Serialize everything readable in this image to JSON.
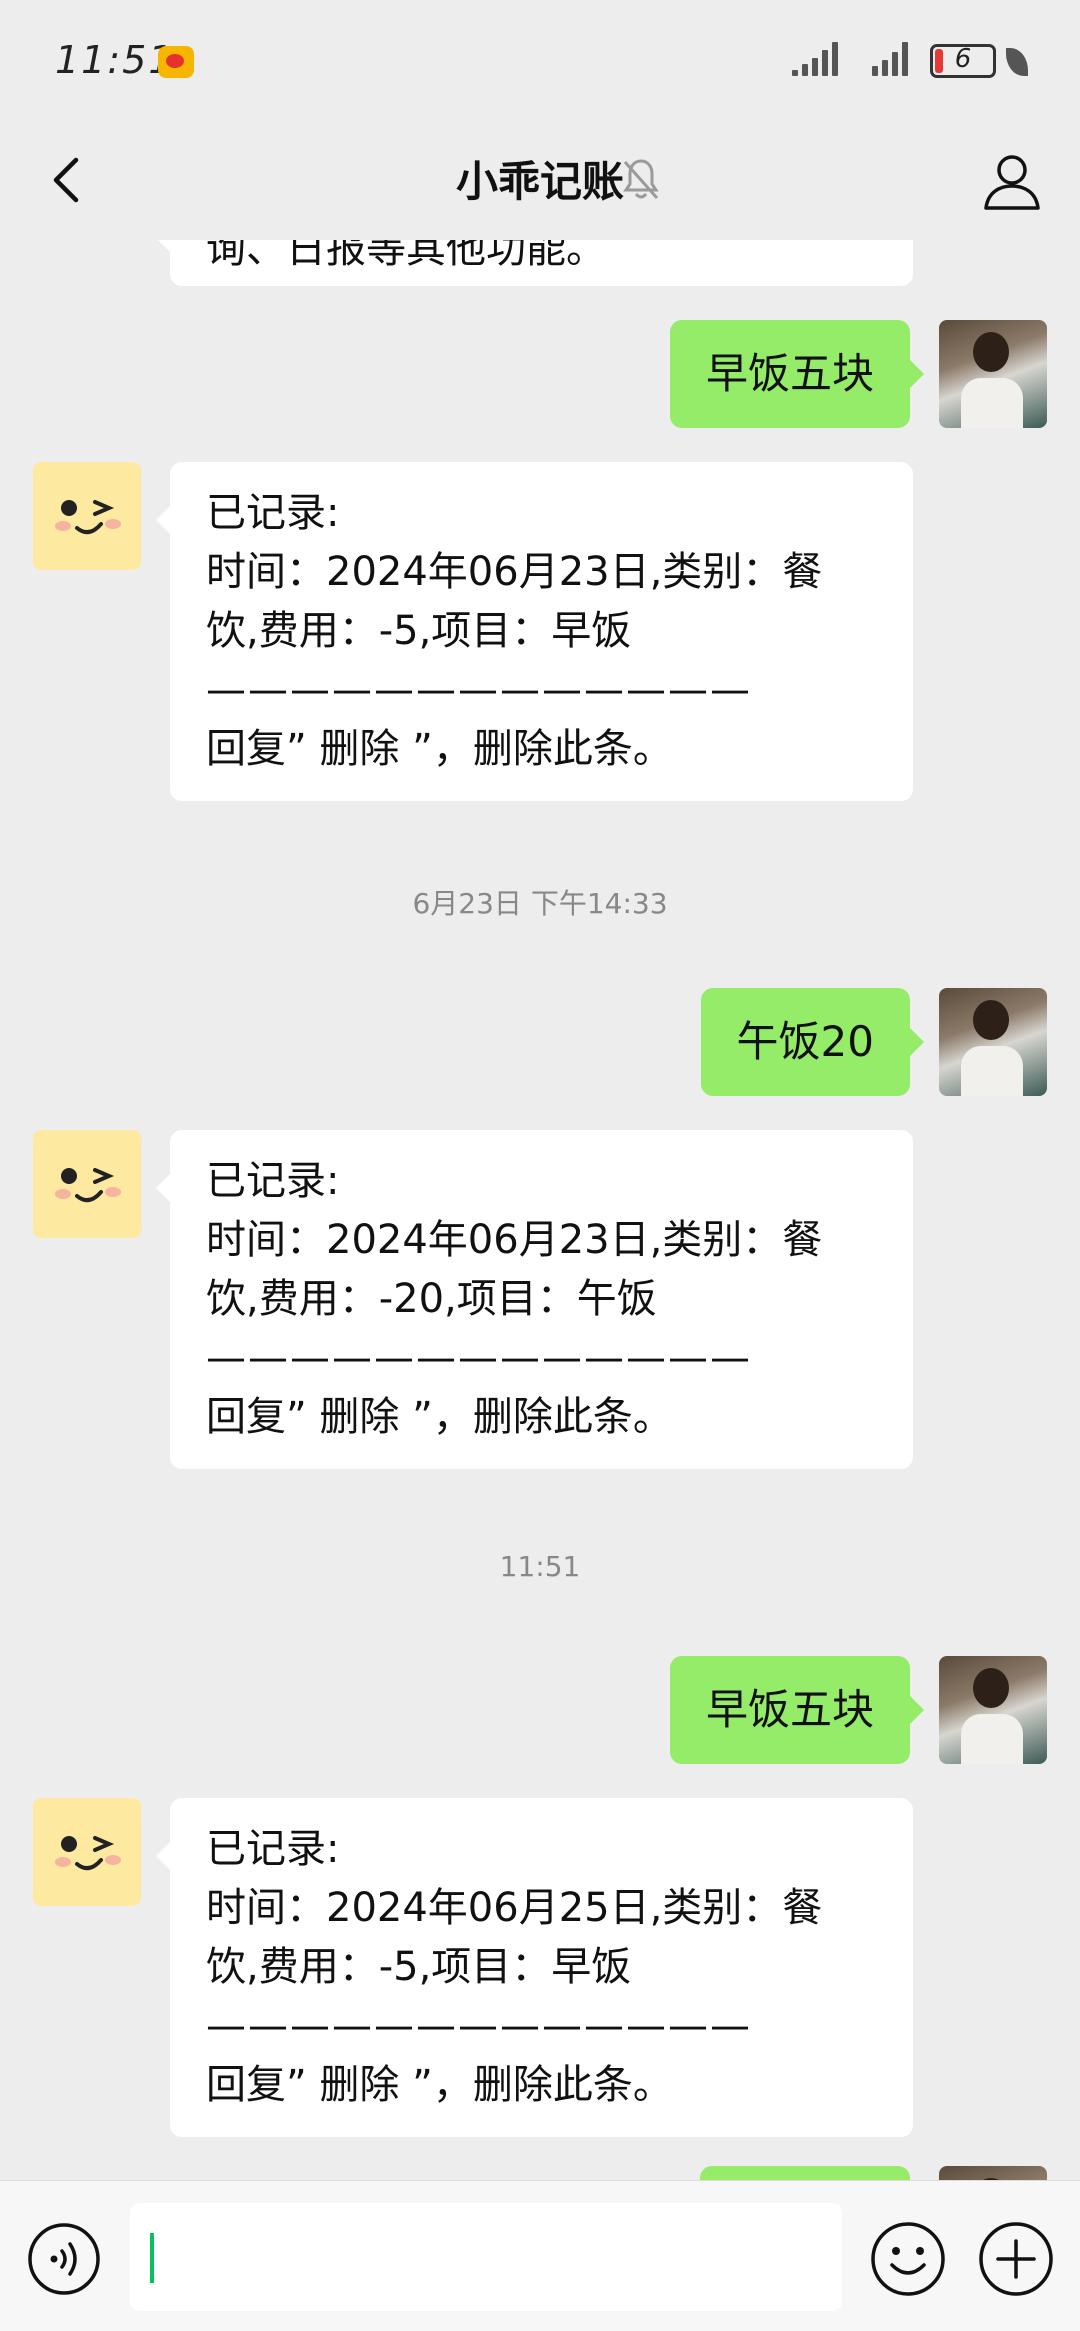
{
  "status_bar": {
    "time": "11:51",
    "battery": "6"
  },
  "header": {
    "title": "小乖记账"
  },
  "messages": {
    "top_partial": "询、日报等其他功能。",
    "m1_user": "早饭五块",
    "m1_bot": {
      "line1": "已记录:",
      "line2": "时间：2024年06月23日,类别：餐",
      "line3": "饮,费用：-5,项目：早饭",
      "dashes": "—————————————",
      "line4": "回复” 删除 ”，删除此条。"
    },
    "ts1": "6月23日 下午14:33",
    "m2_user": "午饭20",
    "m2_bot": {
      "line1": "已记录:",
      "line2": "时间：2024年06月23日,类别：餐",
      "line3": "饮,费用：-20,项目：午饭",
      "dashes": "—————————————",
      "line4": "回复” 删除 ”，删除此条。"
    },
    "ts2": "11:51",
    "m3_user": "早饭五块",
    "m3_bot": {
      "line1": "已记录:",
      "line2": "时间：2024年06月25日,类别：餐",
      "line3": "饮,费用：-5,项目：早饭",
      "dashes": "—————————————",
      "line4": "回复” 删除 ”，删除此条。"
    }
  },
  "colors": {
    "background": "#ededed",
    "outgoing_bubble": "#95ec69",
    "incoming_bubble": "#ffffff",
    "caret": "#07c160"
  },
  "icons": {
    "back": "chevron-left-icon",
    "mute": "bell-off-icon",
    "profile": "person-icon",
    "voice": "voice-icon",
    "emoji": "smile-icon",
    "plus": "plus-circle-icon"
  }
}
